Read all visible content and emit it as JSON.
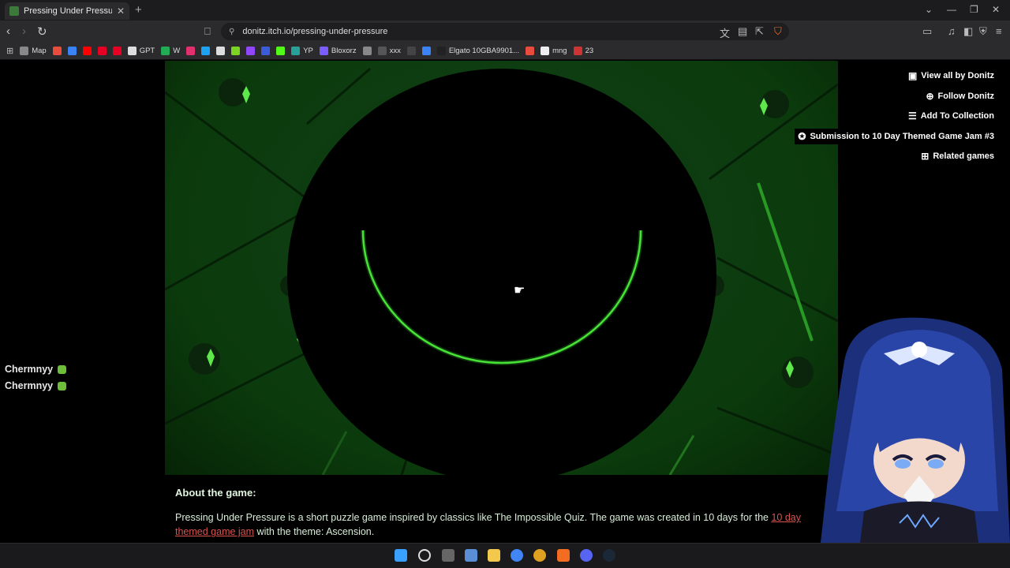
{
  "browser": {
    "tab_title": "Pressing Under Pressure by D",
    "url": "donitz.itch.io/pressing-under-pressure"
  },
  "bookmarks": [
    {
      "label": "Map",
      "color": "#888"
    },
    {
      "label": "",
      "color": "#e74c3c"
    },
    {
      "label": "",
      "color": "#3b82f6"
    },
    {
      "label": "",
      "color": "#ff0000"
    },
    {
      "label": "",
      "color": "#e60023"
    },
    {
      "label": "",
      "color": "#e60023"
    },
    {
      "label": "GPT",
      "color": "#ddd"
    },
    {
      "label": "W",
      "color": "#22aa55"
    },
    {
      "label": "",
      "color": "#e1306c"
    },
    {
      "label": "",
      "color": "#1da1f2"
    },
    {
      "label": "",
      "color": "#ddd"
    },
    {
      "label": "",
      "color": "#7dd321"
    },
    {
      "label": "",
      "color": "#9146ff"
    },
    {
      "label": "",
      "color": "#3b5bdb"
    },
    {
      "label": "",
      "color": "#53fc18"
    },
    {
      "label": "YP",
      "color": "#2aa198"
    },
    {
      "label": "Bloxorz",
      "color": "#7a5cff"
    },
    {
      "label": "",
      "color": "#888"
    },
    {
      "label": "xxx",
      "color": "#555"
    },
    {
      "label": "",
      "color": "#444"
    },
    {
      "label": "",
      "color": "#3b82f6"
    },
    {
      "label": "Elgato 10GBA9901...",
      "color": "#222"
    },
    {
      "label": "",
      "color": "#e74c3c"
    },
    {
      "label": "mng",
      "color": "#eee"
    },
    {
      "label": "23",
      "color": "#cc3333"
    }
  ],
  "sidebar_links": [
    {
      "icon": "gamepad-icon",
      "glyph": "▣",
      "label": "View all by Donitz"
    },
    {
      "icon": "user-plus-icon",
      "glyph": "⊕",
      "label": "Follow Donitz"
    },
    {
      "icon": "list-plus-icon",
      "glyph": "☰",
      "label": "Add To Collection"
    },
    {
      "icon": "award-icon",
      "glyph": "✪",
      "label": "Submission to 10 Day Themed Game Jam #3"
    },
    {
      "icon": "map-icon",
      "glyph": "⊞",
      "label": "Related games"
    }
  ],
  "chat": [
    {
      "user": "Chermnyy"
    },
    {
      "user": "Chermnyy"
    }
  ],
  "about": {
    "title": "About the game:",
    "body_before": "Pressing Under Pressure is a short puzzle game inspired by classics like The Impossible Quiz. The game was created in 10 days for the ",
    "link_text": "10 day themed game jam",
    "body_after": " with the theme: Ascension."
  },
  "colors": {
    "accent_green": "#39d62e",
    "link_red": "#d9534f",
    "page_bg": "#000000"
  }
}
